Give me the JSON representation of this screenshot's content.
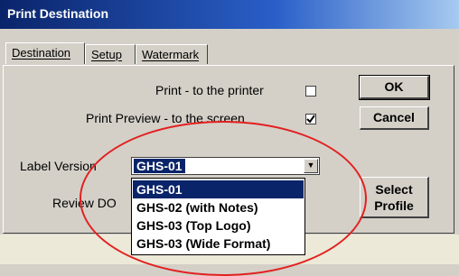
{
  "window": {
    "title": "Print Destination"
  },
  "tabs": [
    {
      "label": "Destination"
    },
    {
      "label": "Setup"
    },
    {
      "label": "Watermark"
    }
  ],
  "options": {
    "print_printer_label": "Print - to the printer",
    "print_printer_checked": false,
    "print_preview_label": "Print Preview - to the screen",
    "print_preview_checked": true
  },
  "label_version": {
    "label": "Label Version",
    "value": "GHS-01",
    "items": [
      "GHS-01",
      "GHS-02 (with Notes)",
      "GHS-03 (Top Logo)",
      "GHS-03 (Wide Format)"
    ]
  },
  "review": {
    "label": "Review DO"
  },
  "buttons": {
    "ok": "OK",
    "cancel": "Cancel",
    "select_profile": "Select Profile"
  },
  "colors": {
    "selection": "#0a246a",
    "annotation": "#e32020"
  }
}
